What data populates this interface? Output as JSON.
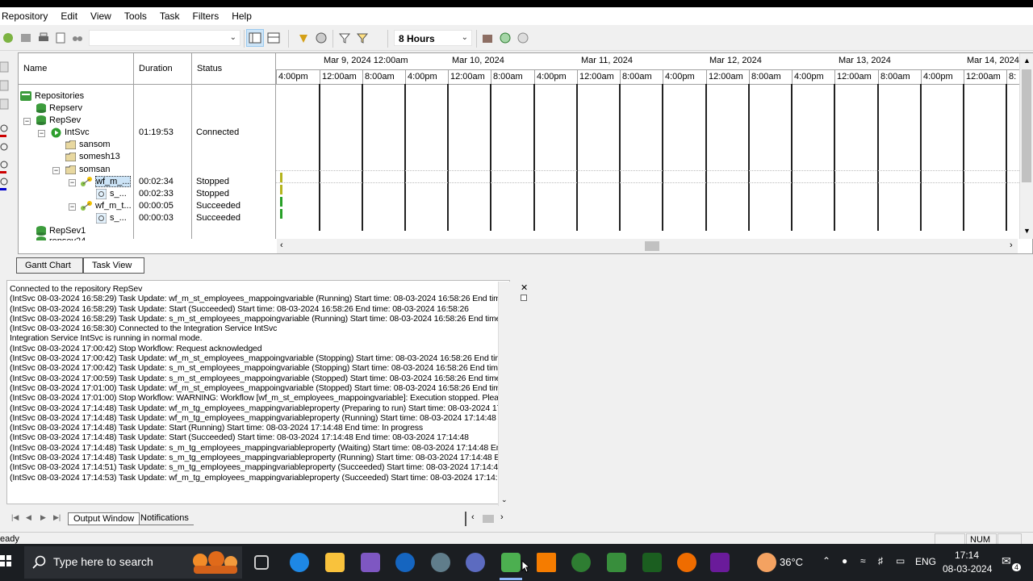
{
  "menu": [
    "Repository",
    "Edit",
    "View",
    "Tools",
    "Task",
    "Filters",
    "Help"
  ],
  "toolbar": {
    "hours_value": "8  Hours",
    "combo_value": ""
  },
  "columns": {
    "name": "Name",
    "duration": "Duration",
    "status": "Status"
  },
  "tree": [
    {
      "label": "Repositories",
      "duration": "",
      "status": ""
    },
    {
      "label": "Repserv",
      "duration": "",
      "status": ""
    },
    {
      "label": "RepSev",
      "duration": "",
      "status": ""
    },
    {
      "label": "IntSvc",
      "duration": "01:19:53",
      "status": "Connected"
    },
    {
      "label": "sansom",
      "duration": "",
      "status": ""
    },
    {
      "label": "somesh13",
      "duration": "",
      "status": ""
    },
    {
      "label": "somsan",
      "duration": "",
      "status": ""
    },
    {
      "label": "wf_m_...",
      "duration": "00:02:34",
      "status": "Stopped"
    },
    {
      "label": "s_...",
      "duration": "00:02:33",
      "status": "Stopped"
    },
    {
      "label": "wf_m_t...",
      "duration": "00:00:05",
      "status": "Succeeded"
    },
    {
      "label": "s_...",
      "duration": "00:00:03",
      "status": "Succeeded"
    },
    {
      "label": "RepSev1",
      "duration": "",
      "status": ""
    },
    {
      "label": "repsev24",
      "duration": "",
      "status": ""
    }
  ],
  "timeline": {
    "dates": [
      "Mar 9, 2024 12:00am",
      "Mar 10, 2024",
      "Mar 11, 2024",
      "Mar 12, 2024",
      "Mar 13, 2024",
      "Mar 14, 2024"
    ],
    "times": [
      "4:00pm",
      "12:00am",
      "8:00am",
      "4:00pm",
      "12:00am",
      "8:00am",
      "4:00pm",
      "12:00am",
      "8:00am",
      "4:00pm",
      "12:00am",
      "8:00am",
      "4:00pm",
      "12:00am",
      "8:00am",
      "4:00pm",
      "12:00am",
      "8:"
    ],
    "bar_colors": {
      "stopped": "#b4b41e",
      "succeeded": "#28a028"
    }
  },
  "view_tabs": [
    "Gantt Chart",
    "Task View"
  ],
  "output_lines": [
    "Connected to the repository RepSev",
    "(IntSvc 08-03-2024 16:58:29) Task Update: wf_m_st_employees_mappoingvariable (Running)  Start time: 08-03-2024 16:58:26 End tim",
    "(IntSvc 08-03-2024 16:58:29) Task Update: Start (Succeeded)  Start time: 08-03-2024 16:58:26 End time: 08-03-2024 16:58:26",
    "(IntSvc 08-03-2024 16:58:29) Task Update: s_m_st_employees_mappoingvariable (Running)  Start time: 08-03-2024 16:58:26 End time",
    "(IntSvc 08-03-2024 16:58:30) Connected to the Integration Service IntSvc",
    "Integration Service IntSvc is running in normal mode.",
    "(IntSvc 08-03-2024 17:00:42) Stop Workflow: Request acknowledged",
    "(IntSvc 08-03-2024 17:00:42) Task Update: wf_m_st_employees_mappoingvariable (Stopping)  Start time: 08-03-2024 16:58:26 End tim",
    "(IntSvc 08-03-2024 17:00:42) Task Update: s_m_st_employees_mappoingvariable (Stopping)  Start time: 08-03-2024 16:58:26 End time",
    "(IntSvc 08-03-2024 17:00:59) Task Update: s_m_st_employees_mappoingvariable (Stopped)  Start time: 08-03-2024 16:58:26 End time",
    "(IntSvc 08-03-2024 17:01:00) Task Update: wf_m_st_employees_mappoingvariable (Stopped)  Start time: 08-03-2024 16:58:26 End tim",
    "(IntSvc 08-03-2024 17:01:00) Stop Workflow: WARNING: Workflow [wf_m_st_employees_mappoingvariable]: Execution stopped.  Plea",
    "(IntSvc 08-03-2024 17:14:48) Task Update: wf_m_tg_employees_mappingvariableproperty (Preparing to run)  Start time: 08-03-2024 17",
    "(IntSvc 08-03-2024 17:14:48) Task Update: wf_m_tg_employees_mappingvariableproperty (Running)  Start time: 08-03-2024 17:14:48",
    "(IntSvc 08-03-2024 17:14:48) Task Update: Start (Running)  Start time: 08-03-2024 17:14:48 End time: In progress",
    "(IntSvc 08-03-2024 17:14:48) Task Update: Start (Succeeded)  Start time: 08-03-2024 17:14:48 End time: 08-03-2024 17:14:48",
    "(IntSvc 08-03-2024 17:14:48) Task Update: s_m_tg_employees_mappingvariableproperty (Waiting)  Start time: 08-03-2024 17:14:48 En",
    "(IntSvc 08-03-2024 17:14:48) Task Update: s_m_tg_employees_mappingvariableproperty (Running)  Start time: 08-03-2024 17:14:48 E",
    "(IntSvc 08-03-2024 17:14:51) Task Update: s_m_tg_employees_mappingvariableproperty (Succeeded)  Start time: 08-03-2024 17:14:4",
    "(IntSvc 08-03-2024 17:14:53) Task Update: wf_m_tg_employees_mappingvariableproperty (Succeeded)  Start time: 08-03-2024 17:14:"
  ],
  "output_tabs": [
    "Output Window",
    "Notifications"
  ],
  "status": {
    "left": "eady",
    "num": "NUM"
  },
  "taskbar": {
    "search_placeholder": "Type here to search",
    "temperature": "36°C",
    "language": "ENG",
    "time": "17:14",
    "date": "08-03-2024",
    "notifications": "4"
  }
}
